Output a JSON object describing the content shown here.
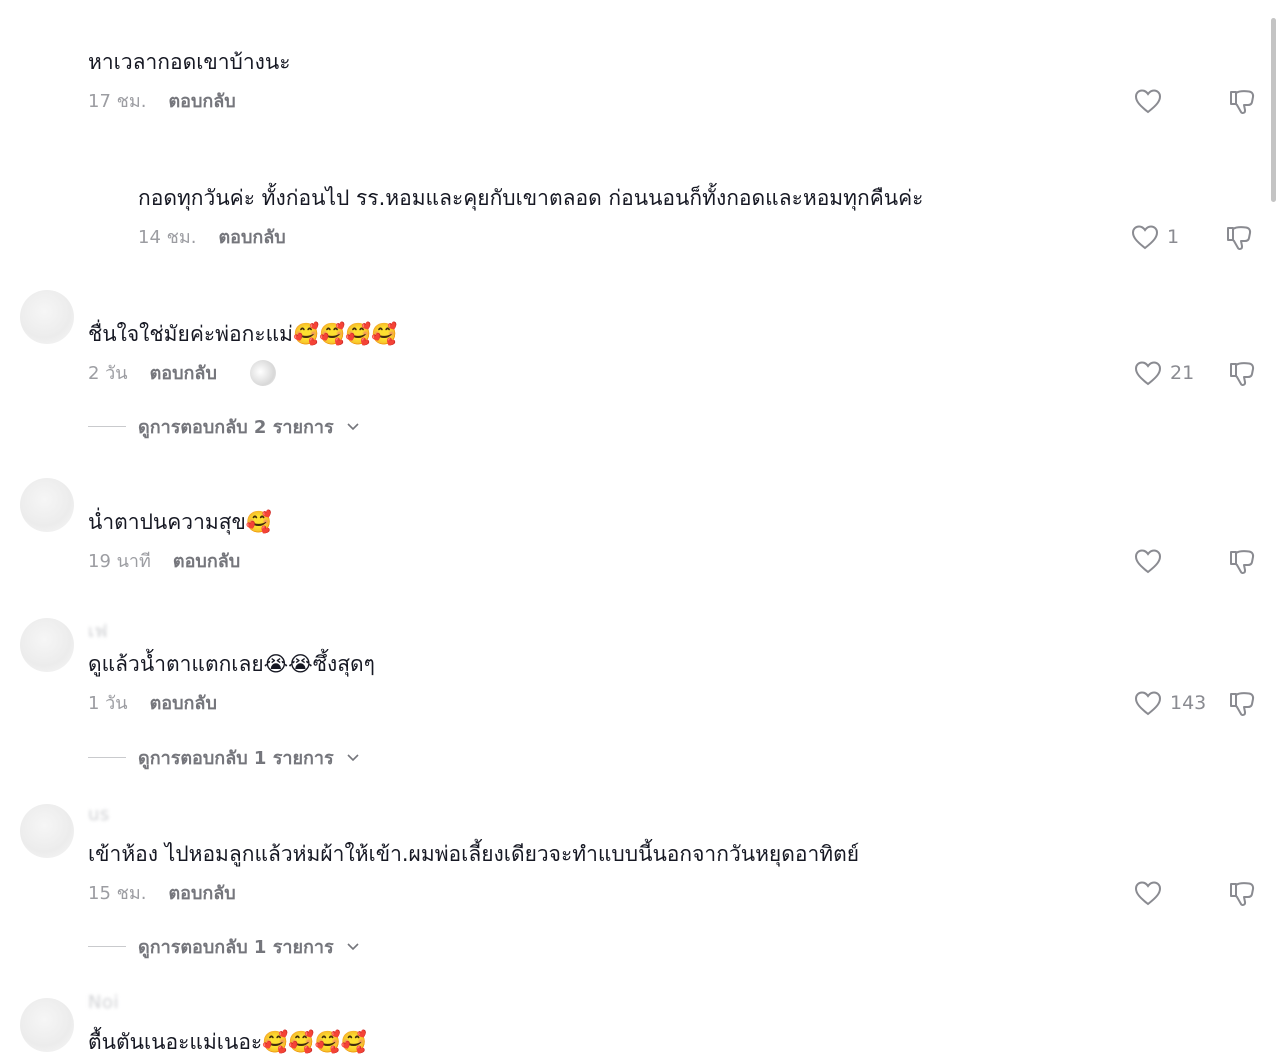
{
  "comments": [
    {
      "author": "",
      "text": "หาเวลากอดเขาบ้างนะ",
      "time": "17 ชม.",
      "reply_label": "ตอบกลับ",
      "likes": ""
    },
    {
      "author": "",
      "text": "กอดทุกวันค่ะ ทั้งก่อนไป รร.หอมและคุยกับเขาตลอด ก่อนนอนก็ทั้งกอดและหอมทุกคืนค่ะ",
      "time": "14 ชม.",
      "reply_label": "ตอบกลับ",
      "likes": "1"
    },
    {
      "author": "",
      "text": "ชื่นใจใช่มัยค่ะพ่อกะแม่🥰🥰🥰🥰",
      "time": "2 วัน",
      "reply_label": "ตอบกลับ",
      "likes": "21",
      "view_replies": "ดูการตอบกลับ 2 รายการ"
    },
    {
      "author": "",
      "text": "น่ำตาปนความสุข🥰",
      "time": "19 นาที",
      "reply_label": "ตอบกลับ",
      "likes": ""
    },
    {
      "author": "เฟ",
      "text": "ดูแล้วน้ำตาแตกเลย😭😭ซึ้งสุดๆ",
      "time": "1 วัน",
      "reply_label": "ตอบกลับ",
      "likes": "143",
      "view_replies": "ดูการตอบกลับ 1 รายการ"
    },
    {
      "author": "us",
      "text": "เข้าห้อง ไปหอมลูกแล้วห่มผ้าให้เข้า.ผมพ่อเลี้ยงเดียวจะทำแบบนี้นอกจากวันหยุดอาทิตย์",
      "time": "15 ชม.",
      "reply_label": "ตอบกลับ",
      "likes": "",
      "view_replies": "ดูการตอบกลับ 1 รายการ"
    },
    {
      "author": "Noi",
      "text": "ตื้นตันเนอะแม่เนอะ🥰🥰🥰🥰",
      "time": "",
      "reply_label": "",
      "likes": ""
    }
  ],
  "icons": {
    "like": "heart-outline-icon",
    "dislike": "thumbs-down-icon",
    "expand": "chevron-down-icon"
  },
  "colors": {
    "text": "#161823",
    "muted": "#9c9da2",
    "reply": "#75767c",
    "icon": "#8a8b91"
  }
}
